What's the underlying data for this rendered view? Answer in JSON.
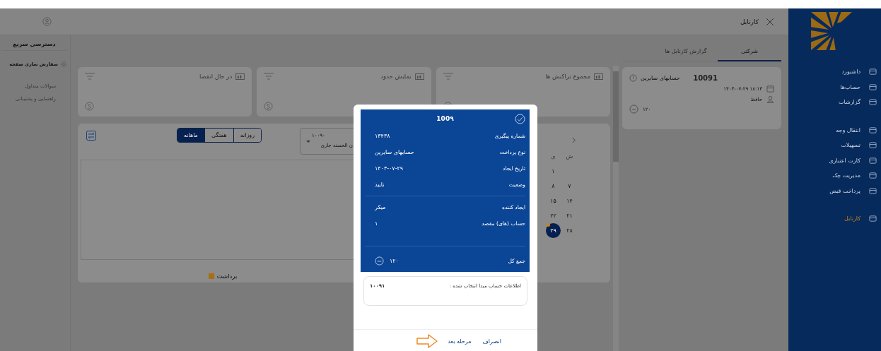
{
  "header": {
    "title": "کارتابل"
  },
  "sidebar": {
    "groups": [
      [
        {
          "label": "داشبورد",
          "selected": false
        },
        {
          "label": "حساب‌ها",
          "selected": false
        },
        {
          "label": "گزارشات",
          "selected": false
        }
      ],
      [
        {
          "label": "انتقال وجه",
          "selected": false
        },
        {
          "label": "تسهیلات",
          "selected": false
        },
        {
          "label": "کارت اعتباری",
          "selected": false
        },
        {
          "label": "مدیریت چک",
          "selected": false
        },
        {
          "label": "پرداخت قبض",
          "selected": false
        }
      ],
      [
        {
          "label": "کارتابل",
          "selected": true
        }
      ]
    ]
  },
  "quick_access": {
    "title": "دسترسی سریع",
    "customize": "سفارش سازی صفحه",
    "links": [
      "سوالات متداول",
      "راهنمایی و پشتیبانی"
    ]
  },
  "summary_cards": [
    {
      "title": "مجموع تراکنش ها"
    },
    {
      "title": "نمایش حدود"
    },
    {
      "title": "در حال انقضا"
    }
  ],
  "chart_panel": {
    "account": {
      "number": "۱۰۰۹۰",
      "name": "ن الحسنه جاری"
    },
    "periods": [
      {
        "label": "روزانه",
        "selected": false
      },
      {
        "label": "هفتگی",
        "selected": false
      },
      {
        "label": "ماهانه",
        "selected": true
      }
    ],
    "legend": [
      {
        "label": "برداشت",
        "color": "#a86e14"
      }
    ]
  },
  "calendar": {
    "weekdays": [
      "ش",
      "ی"
    ],
    "weeks": [
      [
        {
          "day": "۱",
          "selected": false,
          "marked": false
        }
      ],
      [
        {
          "day": "۷",
          "selected": false,
          "marked": false
        },
        {
          "day": "۸",
          "selected": false,
          "marked": false
        }
      ],
      [
        {
          "day": "۱۴",
          "selected": false,
          "marked": false
        },
        {
          "day": "۱۵",
          "selected": false,
          "marked": false
        }
      ],
      [
        {
          "day": "۲۱",
          "selected": false,
          "marked": false
        },
        {
          "day": "۲۲",
          "selected": false,
          "marked": false
        }
      ],
      [
        {
          "day": "۲۸",
          "selected": false,
          "marked": false
        },
        {
          "day": "۲۹",
          "selected": true,
          "marked": true
        }
      ]
    ]
  },
  "tabs": [
    {
      "label": "شرکتی",
      "selected": true
    },
    {
      "label": "گزارش کارتابل ها",
      "selected": false
    }
  ],
  "cartable_item": {
    "number": "10091",
    "type": "حسابهای سایرین",
    "datetime": "۱۸:۱۳ ۱۴۰۳-۰۷-۲۹",
    "user": "حافظ",
    "amount": "۱۲۰"
  },
  "modal": {
    "title": "100۹",
    "fields": [
      {
        "label": "شماره پیگیری",
        "value": "۱۳۴۳۸"
      },
      {
        "label": "نوع پرداخت",
        "value": "حسابهای سایرین"
      },
      {
        "label": "تاریخ ایجاد",
        "value": "۱۴۰۳-۰۷-۲۹"
      },
      {
        "label": "وضعیت",
        "value": "تایید"
      }
    ],
    "details": [
      {
        "label": "ایجاد کننده",
        "value": "میکر"
      },
      {
        "label": "حساب (های) مقصد",
        "value": "۱"
      }
    ],
    "total": {
      "label": "جمع کل",
      "value": "۱۲۰"
    },
    "source": {
      "label": "اطلاعات حساب مبدا انتخاب شده :",
      "value": "۱۰۰۹۱"
    },
    "buttons": {
      "cancel": "انصراف",
      "next": "مرحله بعد"
    }
  }
}
